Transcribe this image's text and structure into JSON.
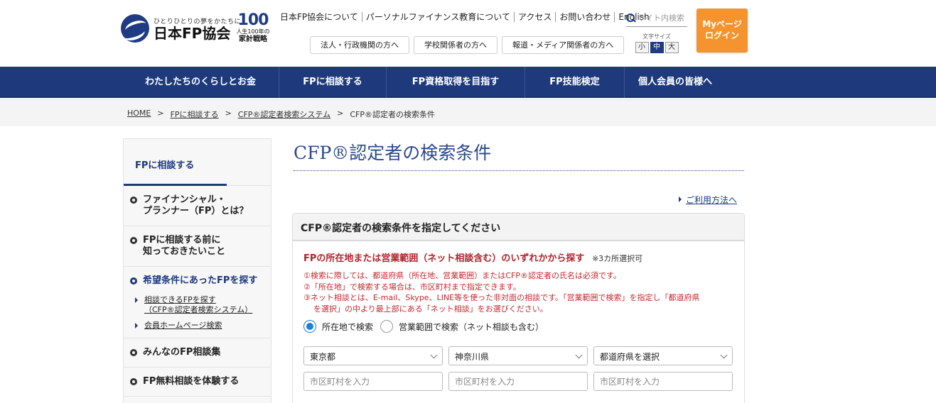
{
  "header": {
    "logo_tagline": "ひとりひとりの夢をかたちに",
    "logo_name": "日本FP協会",
    "badge_number": "100",
    "badge_line1": "人生100年の",
    "badge_line2": "家計戦略",
    "top_links": [
      "日本FP協会について",
      "パーソナルファイナンス教育について",
      "アクセス",
      "お問い合わせ",
      "English"
    ],
    "search_placeholder": "サイト内検索",
    "font_size_label": "文字サイズ",
    "font_sizes": [
      "小",
      "中",
      "大"
    ],
    "font_size_selected": "中",
    "mypage_line1": "Myページ",
    "mypage_line2": "ログイン",
    "sub_links": [
      "法人・行政機関の方へ",
      "学校関係者の方へ",
      "報道・メディア関係者の方へ"
    ]
  },
  "main_nav": [
    "わたしたちのくらしとお金",
    "FPに相談する",
    "FP資格取得を目指す",
    "FP技能検定",
    "個人会員の皆様へ"
  ],
  "breadcrumb": [
    "HOME",
    "FPに相談する",
    "CFP®認定者検索システム",
    "CFP®認定者の検索条件"
  ],
  "sidebar": {
    "title": "FPに相談する",
    "items": [
      {
        "line1": "ファイナンシャル・",
        "line2": "プランナー（FP）とは？"
      },
      {
        "line1": "FPに相談する前に",
        "line2": "知っておきたいこと"
      },
      {
        "line1": "希望条件にあったFPを探す",
        "line2": ""
      },
      {
        "line1": "みんなのFP相談集",
        "line2": ""
      },
      {
        "line1": "FP無料相談を体験する",
        "line2": ""
      }
    ],
    "sub_items": [
      {
        "line1": "相談できるFPを探す",
        "line2": "（CFP®認定者検索システム）"
      },
      {
        "line1": "会員ホームページ検索",
        "line2": ""
      }
    ]
  },
  "content": {
    "page_title": "CFP®認定者の検索条件",
    "usage_link": "ご利用方法へ",
    "panel_title": "CFP®認定者の検索条件を指定してください",
    "panel_subtitle": "FPの所在地または営業範囲（ネット相談含む）のいずれかから探す",
    "panel_subtitle_note": "※3カ所選択可",
    "note1": "①検索に際しては、都道府県（所在地、営業範囲）またはCFP®認定者の氏名は必須です。",
    "note2": "②「所在地」で検索する場合は、市区町村まで指定できます。",
    "note3a": "③ネット相談とは、E-mail、Skype、LINE等を使った非対面の相談です。「営業範囲で検索」を指定し「都道府県",
    "note3b": "を選択」の中より最上部にある「ネット相談」をお選びください。",
    "radio_location": "所在地で検索",
    "radio_area": "営業範囲で検索（ネット相談も含む）",
    "radio_selected": "所在地で検索",
    "select1": "東京都",
    "select2": "神奈川県",
    "select3": "都道府県を選択",
    "city_placeholder": "市区町村を入力"
  },
  "colors": {
    "navy": "#1e3a7c",
    "orange": "#f5942f",
    "red_text": "#b0232a",
    "radio_blue": "#1e7fd6"
  }
}
